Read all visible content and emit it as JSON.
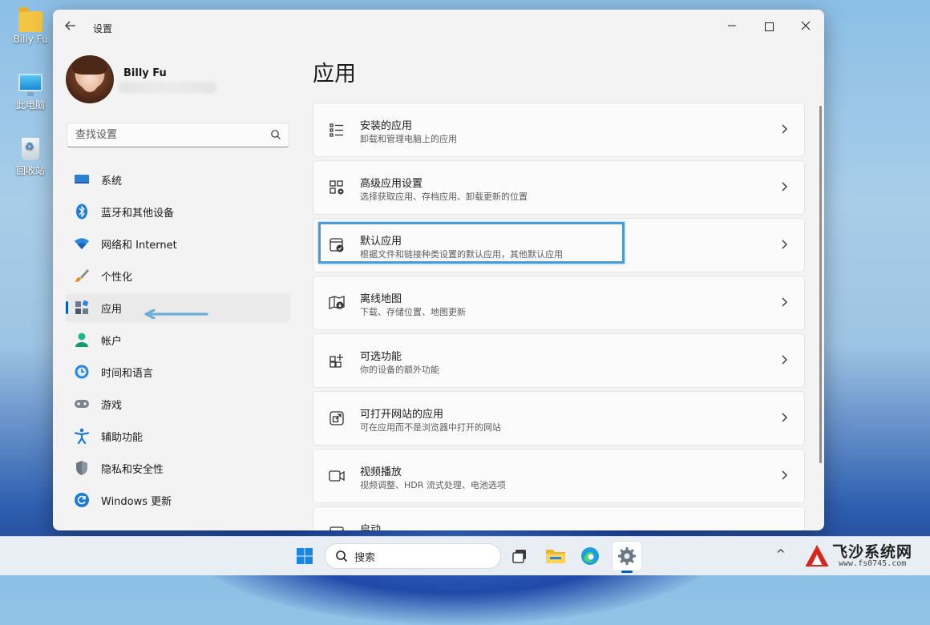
{
  "desktop": {
    "icons": [
      {
        "label": "Billy Fu",
        "icon": "folder-icon"
      },
      {
        "label": "此电脑",
        "icon": "this-pc-icon"
      },
      {
        "label": "回收站",
        "icon": "recycle-bin-icon"
      }
    ]
  },
  "window": {
    "title": "设置",
    "controls": {
      "minimize": "—",
      "maximize": "□",
      "close": "✕"
    }
  },
  "user": {
    "name": "Billy Fu"
  },
  "search": {
    "placeholder": "查找设置"
  },
  "sidebar": {
    "items": [
      {
        "label": "系统",
        "icon": "system-icon",
        "active": false
      },
      {
        "label": "蓝牙和其他设备",
        "icon": "bluetooth-icon",
        "active": false
      },
      {
        "label": "网络和 Internet",
        "icon": "wifi-icon",
        "active": false
      },
      {
        "label": "个性化",
        "icon": "brush-icon",
        "active": false
      },
      {
        "label": "应用",
        "icon": "apps-icon",
        "active": true
      },
      {
        "label": "帐户",
        "icon": "account-icon",
        "active": false
      },
      {
        "label": "时间和语言",
        "icon": "time-language-icon",
        "active": false
      },
      {
        "label": "游戏",
        "icon": "gamepad-icon",
        "active": false
      },
      {
        "label": "辅助功能",
        "icon": "accessibility-icon",
        "active": false
      },
      {
        "label": "隐私和安全性",
        "icon": "shield-icon",
        "active": false
      },
      {
        "label": "Windows 更新",
        "icon": "update-icon",
        "active": false
      }
    ]
  },
  "main": {
    "title": "应用",
    "cards": [
      {
        "title": "安装的应用",
        "subtitle": "卸载和管理电脑上的应用",
        "icon": "installed-apps-icon"
      },
      {
        "title": "高级应用设置",
        "subtitle": "选择获取应用、存档应用、卸载更新的位置",
        "icon": "advanced-app-settings-icon"
      },
      {
        "title": "默认应用",
        "subtitle": "根据文件和链接种类设置的默认应用，其他默认应用",
        "icon": "default-apps-icon",
        "highlighted": true
      },
      {
        "title": "离线地图",
        "subtitle": "下载、存储位置、地图更新",
        "icon": "offline-maps-icon"
      },
      {
        "title": "可选功能",
        "subtitle": "你的设备的额外功能",
        "icon": "optional-features-icon"
      },
      {
        "title": "可打开网站的应用",
        "subtitle": "可在应用而不是浏览器中打开的网站",
        "icon": "apps-for-websites-icon"
      },
      {
        "title": "视频播放",
        "subtitle": "视频调整、HDR 流式处理、电池选项",
        "icon": "video-playback-icon"
      },
      {
        "title": "启动",
        "subtitle": "",
        "icon": "startup-icon"
      }
    ]
  },
  "taskbar": {
    "search_label": "搜索",
    "apps": [
      "start-icon",
      "task-view-icon",
      "file-explorer-icon",
      "edge-icon",
      "settings-icon"
    ],
    "tray_chevron": "^"
  },
  "watermark": {
    "name": "飞沙系统网",
    "url": "www.fs0745.com"
  },
  "colors": {
    "accent": "#005fb8",
    "highlight_border": "#4a9bd4"
  }
}
